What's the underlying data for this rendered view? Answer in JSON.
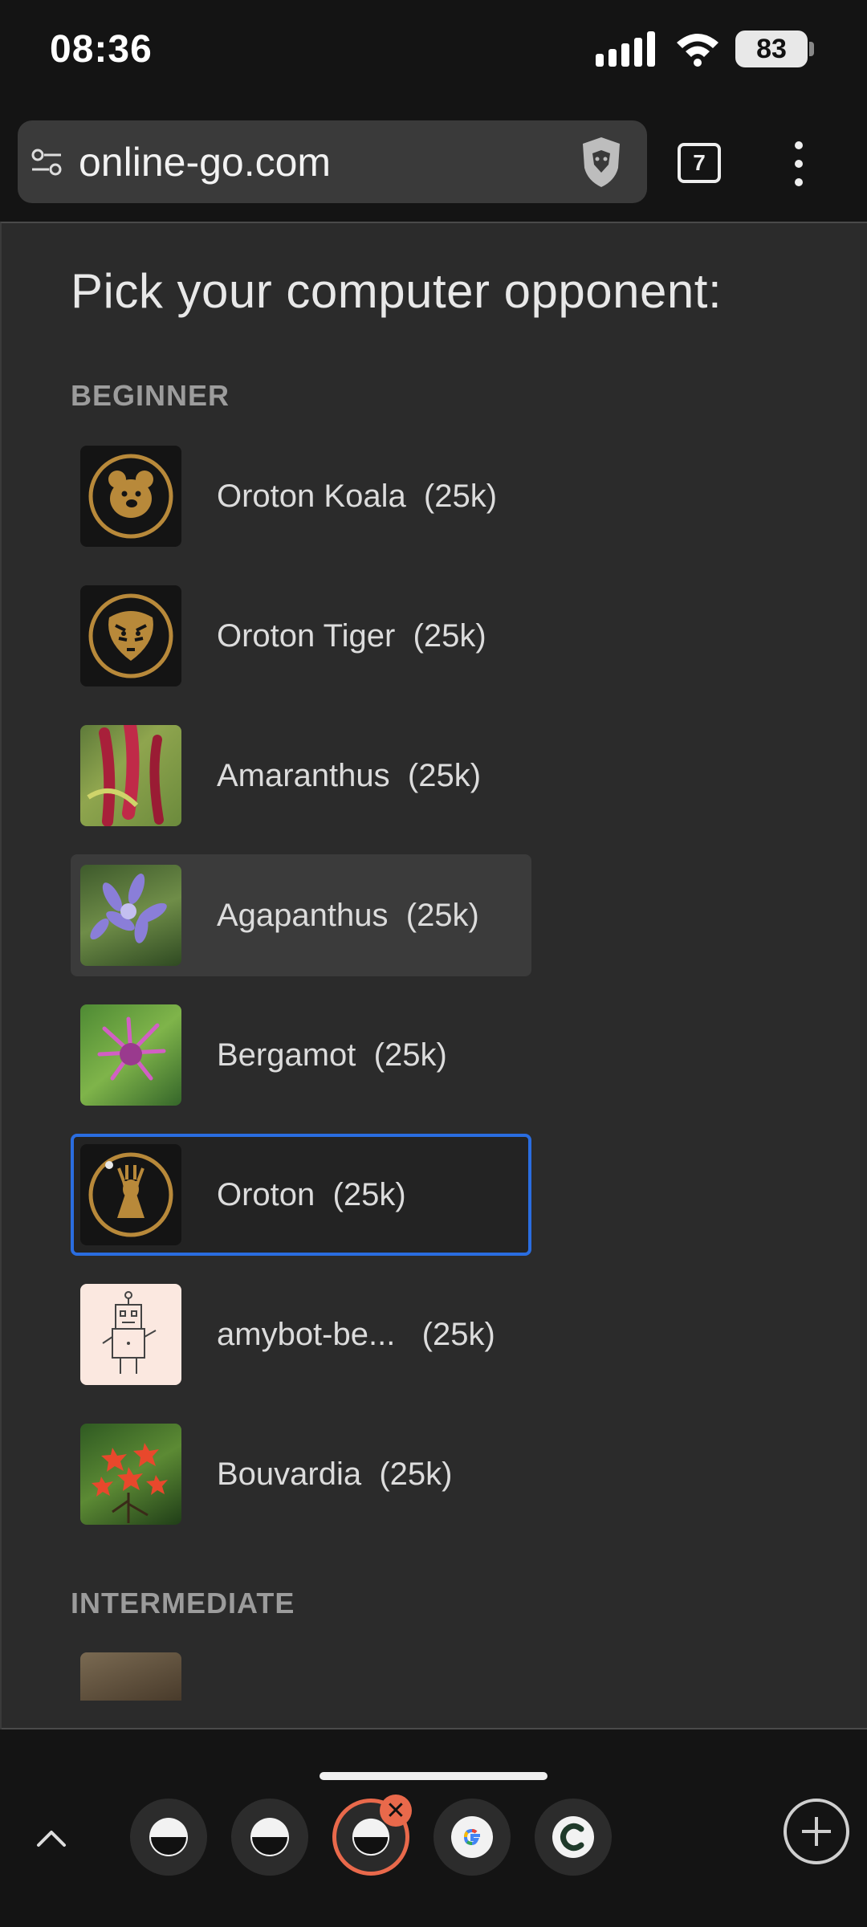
{
  "status": {
    "time": "08:36",
    "battery": "83"
  },
  "browser": {
    "url": "online-go.com",
    "tab_count": "7"
  },
  "modal": {
    "title": "Pick your computer opponent:",
    "sections": {
      "beginner": "BEGINNER",
      "intermediate": "INTERMEDIATE"
    },
    "bots": [
      {
        "label": "Oroton Koala  (25k)",
        "avatar": "koala-icon"
      },
      {
        "label": "Oroton Tiger  (25k)",
        "avatar": "tiger-icon"
      },
      {
        "label": "Amaranthus  (25k)",
        "avatar": "amaranthus-photo"
      },
      {
        "label": "Agapanthus  (25k)",
        "avatar": "agapanthus-photo",
        "state": "hovered"
      },
      {
        "label": "Bergamot  (25k)",
        "avatar": "bergamot-photo"
      },
      {
        "label": "Oroton  (25k)",
        "avatar": "deer-icon",
        "state": "selected"
      },
      {
        "label": "amybot-be...   (25k)",
        "avatar": "robot-sketch"
      },
      {
        "label": "Bouvardia  (25k)",
        "avatar": "bouvardia-photo"
      }
    ]
  },
  "colors": {
    "accent": "#2a6de0",
    "gold": "#b8893a",
    "close": "#e9694b"
  }
}
